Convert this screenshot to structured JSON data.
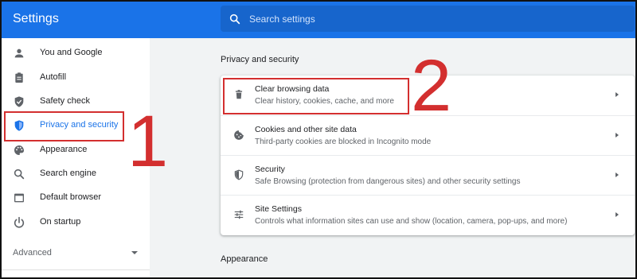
{
  "header": {
    "title": "Settings",
    "search_placeholder": "Search settings"
  },
  "sidebar": {
    "items": [
      {
        "label": "You and Google",
        "icon": "person-icon"
      },
      {
        "label": "Autofill",
        "icon": "clipboard-icon"
      },
      {
        "label": "Safety check",
        "icon": "shield-check-icon"
      },
      {
        "label": "Privacy and security",
        "icon": "shield-icon",
        "active": true
      },
      {
        "label": "Appearance",
        "icon": "palette-icon"
      },
      {
        "label": "Search engine",
        "icon": "search-icon"
      },
      {
        "label": "Default browser",
        "icon": "browser-icon"
      },
      {
        "label": "On startup",
        "icon": "power-icon"
      }
    ],
    "advanced_label": "Advanced"
  },
  "main": {
    "section_title": "Privacy and security",
    "rows": [
      {
        "title": "Clear browsing data",
        "desc": "Clear history, cookies, cache, and more",
        "icon": "trash-icon"
      },
      {
        "title": "Cookies and other site data",
        "desc": "Third-party cookies are blocked in Incognito mode",
        "icon": "cookie-icon"
      },
      {
        "title": "Security",
        "desc": "Safe Browsing (protection from dangerous sites) and other security settings",
        "icon": "shield-icon"
      },
      {
        "title": "Site Settings",
        "desc": "Controls what information sites can use and show (location, camera, pop-ups, and more)",
        "icon": "tune-icon"
      }
    ],
    "next_section_title": "Appearance"
  },
  "annotations": {
    "step1": "1",
    "step2": "2",
    "color": "#d32f2f"
  },
  "colors": {
    "accent": "#1a73e8",
    "header_bg": "#1a73e8",
    "page_bg": "#f1f3f4"
  }
}
